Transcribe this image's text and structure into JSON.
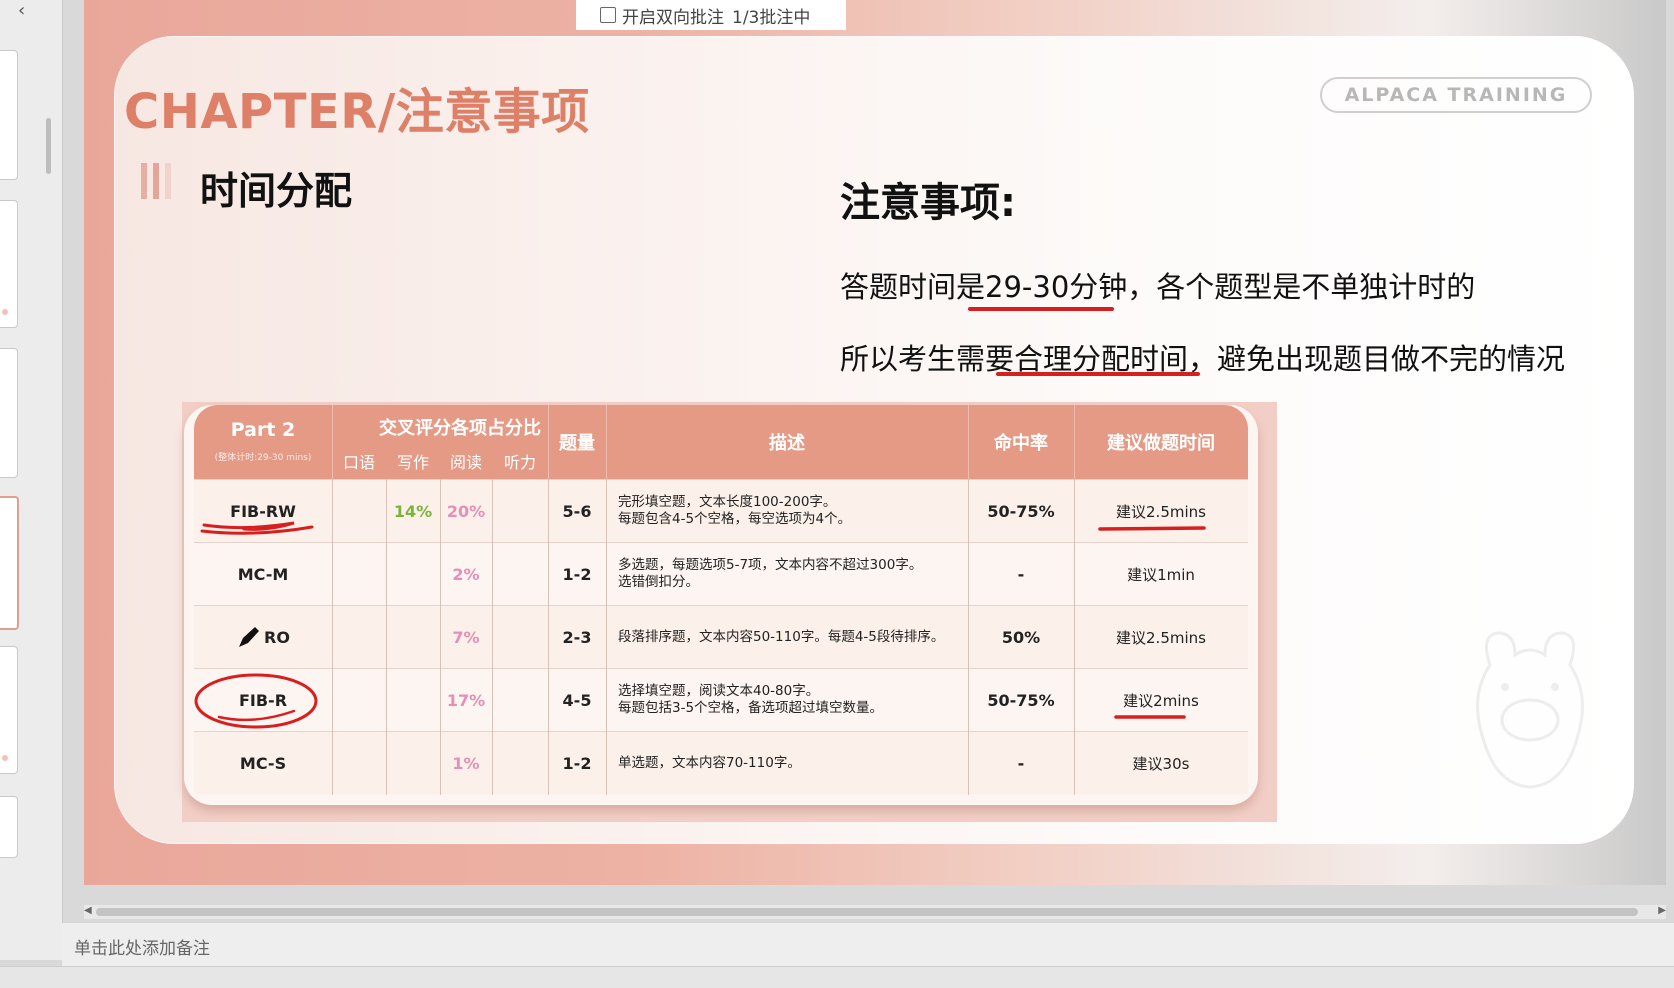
{
  "toolbar": {
    "comment_toggle_label": "开启双向批注",
    "comment_progress": "1/3批注中"
  },
  "slide": {
    "chapter_title": "CHAPTER/注意事项",
    "brand_badge": "ALPACA TRAINING",
    "section_title": "时间分配",
    "notes_title": "注意事项:",
    "note_line1_before": "答题时间是",
    "note_line1_highlight": "29-30分钟",
    "note_line1_after": "，各个题型是不单独计时的",
    "note_line2_before": "所以考生需要",
    "note_line2_highlight": "合理分配时间",
    "note_line2_after": "，避免出现题目做不完的情况"
  },
  "table": {
    "header": {
      "part": "Part 2",
      "part_sub": "(整体计时:29-30 mins)",
      "cross": "交叉评分各项占分比",
      "speaking": "口语",
      "writing": "写作",
      "reading": "阅读",
      "listening": "听力",
      "count": "题量",
      "description": "描述",
      "hit_rate": "命中率",
      "suggested_time": "建议做题时间"
    },
    "rows": [
      {
        "type": "FIB-RW",
        "speaking": "",
        "writing": "14%",
        "reading": "20%",
        "listening": "",
        "count": "5-6",
        "desc1": "完形填空题，文本长度100-200字。",
        "desc2": "每题包含4-5个空格，每空选项为4个。",
        "hit": "50-75%",
        "time": "建议2.5mins"
      },
      {
        "type": "MC-M",
        "speaking": "",
        "writing": "",
        "reading": "2%",
        "listening": "",
        "count": "1-2",
        "desc1": "多选题，每题选项5-7项，文本内容不超过300字。",
        "desc2": "选错倒扣分。",
        "hit": "-",
        "time": "建议1min"
      },
      {
        "type": "RO",
        "speaking": "",
        "writing": "",
        "reading": "7%",
        "listening": "",
        "count": "2-3",
        "desc1": "段落排序题，文本内容50-110字。每题4-5段待排序。",
        "desc2": "",
        "hit": "50%",
        "time": "建议2.5mins"
      },
      {
        "type": "FIB-R",
        "speaking": "",
        "writing": "",
        "reading": "17%",
        "listening": "",
        "count": "4-5",
        "desc1": "选择填空题，阅读文本40-80字。",
        "desc2": "每题包括3-5个空格，备选项超过填空数量。",
        "hit": "50-75%",
        "time": "建议2mins"
      },
      {
        "type": "MC-S",
        "speaking": "",
        "writing": "",
        "reading": "1%",
        "listening": "",
        "count": "1-2",
        "desc1": "单选题，文本内容70-110字。",
        "desc2": "",
        "hit": "-",
        "time": "建议30s"
      }
    ]
  },
  "notes_pane": {
    "placeholder": "单击此处添加备注"
  },
  "colors": {
    "accent": "#de7f68",
    "header_band": "#e59a86",
    "ink_red": "#d71f1f",
    "pct_green": "#7ab53a",
    "pct_pink": "#e58fb8"
  },
  "icons": [
    "collapse-arrow-icon",
    "checkbox-icon",
    "pen-icon",
    "alpaca-watermark-icon",
    "scroll-left-arrow-icon",
    "scroll-right-arrow-icon"
  ]
}
